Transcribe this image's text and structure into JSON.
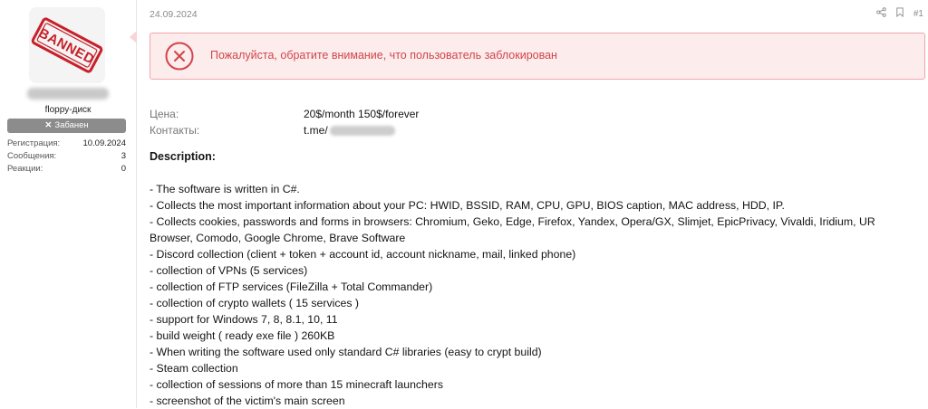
{
  "post": {
    "date": "24.09.2024",
    "number": "#1",
    "alert_text": "Пожалуйста, обратите внимание, что пользователь заблокирован"
  },
  "user": {
    "avatar_stamp": "BANNED",
    "username": "floppy-диск",
    "banned_label": "Забанен",
    "stats": [
      {
        "label": "Регистрация:",
        "value": "10.09.2024"
      },
      {
        "label": "Сообщения:",
        "value": "3"
      },
      {
        "label": "Реакции:",
        "value": "0"
      }
    ]
  },
  "meta": {
    "price_label": "Цена:",
    "price_value": "20$/month 150$/forever",
    "contacts_label": "Контакты:",
    "contacts_value": "t.me/"
  },
  "description": {
    "title": "Description:",
    "features": [
      "- The software is written in C#.",
      "- Collects the most important information about your PC: HWID, BSSID, RAM, CPU, GPU, BIOS caption, MAC address, HDD, IP.",
      "- Collects cookies, passwords and forms in browsers: Chromium, Geko, Edge, Firefox, Yandex, Opera/GX, Slimjet, EpicPrivacy, Vivaldi, Iridium, UR Browser, Comodo, Google Chrome, Brave Software",
      "- Discord collection (client + token + account id, account nickname, mail, linked phone)",
      "- collection of VPNs (5 services)",
      "- collection of FTP services (FileZilla + Total Commander)",
      "- collection of crypto wallets ( 15 services )",
      "- support for Windows 7, 8, 8.1, 10, 11",
      "- build weight ( ready exe file ) 260KB",
      "- When writing the software used only standard C# libraries (easy to crypt build)",
      "- Steam collection",
      "- collection of sessions of more than 15 minecraft launchers",
      "- screenshot of the victim's main screen"
    ]
  },
  "colors": {
    "alert_bg": "#fdecec",
    "alert_border": "#f1a7aa",
    "alert_text": "#d0454c",
    "badge_bg": "#8c8c8c",
    "stamp_red": "#c8202a"
  }
}
